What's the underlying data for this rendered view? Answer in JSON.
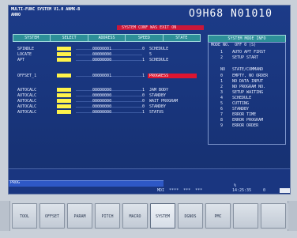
{
  "header": {
    "line1": "MULTI-FUNC SYSTEM V1.0 ANMK-B",
    "line2": "ANNO",
    "program_id": "O9H68 N01010",
    "alarm": "SYSTEM CONF WAS EXIT ON"
  },
  "table": {
    "columns": [
      "SYSTEM",
      "SELECT",
      "ADDRESS",
      "SPEED",
      "STATE"
    ],
    "rows": [
      {
        "name": "SPINDLE",
        "value": "00000001",
        "num": "0",
        "state": "SCHEDULE"
      },
      {
        "name": "LOCATE",
        "value": "00000000",
        "num": "",
        "state": "5"
      },
      {
        "name": "APT",
        "value": "00000000",
        "num": "1",
        "state": "SCHEDULE"
      },
      {
        "name": "OFFSET_1",
        "value": "00000001",
        "num": "1",
        "state": "PROGRESS"
      },
      {
        "name": "AUTOCALC",
        "value": "00000000",
        "num": "1",
        "state": "JAM BODY"
      },
      {
        "name": "AUTOCALC",
        "value": "00000000",
        "num": "0",
        "state": "STANDBY"
      },
      {
        "name": "AUTOCALC",
        "value": "00000000",
        "num": "0",
        "state": "WAIT PROGRAM"
      },
      {
        "name": "AUTOCALC",
        "value": "00000000",
        "num": "0",
        "state": "STANDBY"
      },
      {
        "name": "AUTOCALC",
        "value": "00000000",
        "num": "1",
        "state": "STATUS"
      }
    ]
  },
  "right_panel": {
    "title": "SYSTEM MODE INFO",
    "subtitle": "MODE NO.  OFF 0 (S)",
    "items": [
      {
        "num": "1",
        "label": "AUTO APT FIRST"
      },
      {
        "num": "2",
        "label": "SETUP START"
      }
    ],
    "sub_header": {
      "num": "NO",
      "label": "STATE/COMMAND"
    },
    "list": [
      {
        "num": "0",
        "label": "EMPTY, NO ORDER"
      },
      {
        "num": "1",
        "label": "NO DATA INPUT"
      },
      {
        "num": "2",
        "label": "NO PROGRAM NO."
      },
      {
        "num": "3",
        "label": "SETUP WAITING"
      },
      {
        "num": "4",
        "label": "SCHEDULE"
      },
      {
        "num": "5",
        "label": "CUTTING"
      },
      {
        "num": "6",
        "label": "STANDBY"
      },
      {
        "num": "7",
        "label": "ERROR TIME"
      },
      {
        "num": "8",
        "label": "ERROR PROGRAM"
      },
      {
        "num": "9",
        "label": "ERROR ORDER"
      }
    ]
  },
  "progress": {
    "label": "PROG",
    "fraction": 0.55
  },
  "status_bar": {
    "left": "MDI  ****  ***  ***",
    "percent": "%",
    "time": "14:25:35",
    "right": "0"
  },
  "softkeys": [
    "TOOL",
    "OFFSET",
    "PARAM",
    "PITCH",
    "MACRO",
    "SYSTEM",
    "DGNOS",
    "PMC",
    "",
    "",
    ""
  ],
  "active_softkey": 5,
  "colors": {
    "screen": "#1a3680",
    "header": "#2d8f98",
    "alarm": "#c9173a",
    "highlight": "#fff34a"
  }
}
